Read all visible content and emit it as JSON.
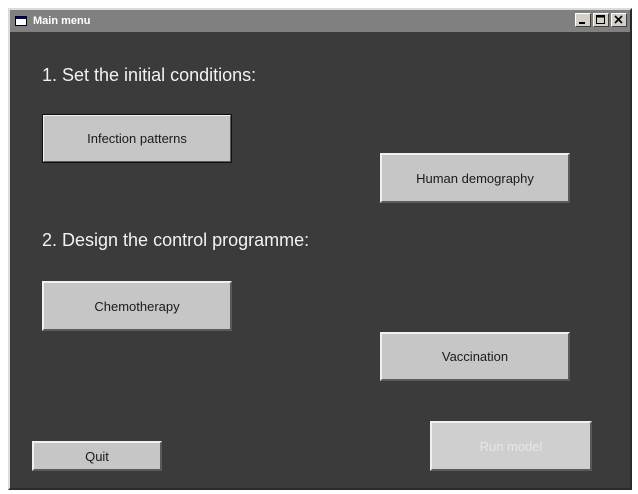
{
  "window": {
    "title": "Main menu",
    "icon": "app-window-icon",
    "controls": [
      "minimize-icon",
      "maximize-icon",
      "close-icon"
    ]
  },
  "sections": {
    "initial_conditions": "1. Set the initial conditions:",
    "control_programme": "2. Design the control programme:"
  },
  "buttons": {
    "infection_patterns": "Infection patterns",
    "human_demography": "Human demography",
    "chemotherapy": "Chemotherapy",
    "vaccination": "Vaccination",
    "quit": "Quit",
    "run_model": "Run model"
  },
  "states": {
    "run_model_disabled": true,
    "focused_button": "infection_patterns"
  },
  "colors": {
    "window_background": "#3b3b3b",
    "titlebar": "#808080",
    "button_face": "#c6c6c6",
    "heading_text": "#f2f2f2"
  }
}
